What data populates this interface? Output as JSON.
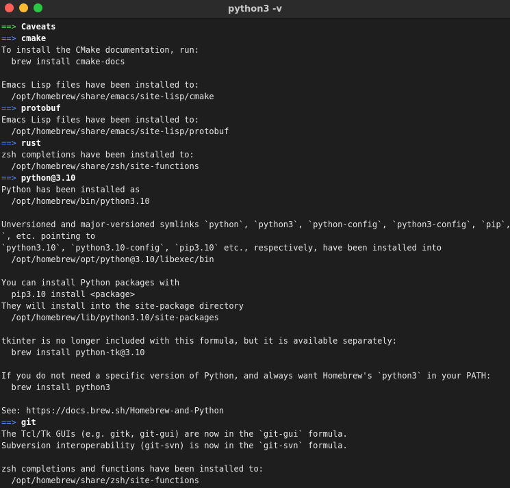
{
  "window": {
    "title": "python3 -v",
    "buttons": [
      "close",
      "minimize",
      "maximize"
    ]
  },
  "colors": {
    "green_arrow": "#5fd35f",
    "blue_arrow": "#5c8cff",
    "text": "#e6e6e6",
    "background": "#1e1e1e"
  },
  "lines": [
    {
      "type": "header",
      "arrow": "==>",
      "color": "green",
      "text": "Caveats"
    },
    {
      "type": "header",
      "arrow": "==>",
      "color": "blue",
      "text": "cmake"
    },
    {
      "type": "text",
      "text": "To install the CMake documentation, run:"
    },
    {
      "type": "text",
      "text": "  brew install cmake-docs"
    },
    {
      "type": "text",
      "text": ""
    },
    {
      "type": "text",
      "text": "Emacs Lisp files have been installed to:"
    },
    {
      "type": "text",
      "text": "  /opt/homebrew/share/emacs/site-lisp/cmake"
    },
    {
      "type": "header",
      "arrow": "==>",
      "color": "blue",
      "text": "protobuf"
    },
    {
      "type": "text",
      "text": "Emacs Lisp files have been installed to:"
    },
    {
      "type": "text",
      "text": "  /opt/homebrew/share/emacs/site-lisp/protobuf"
    },
    {
      "type": "header",
      "arrow": "==>",
      "color": "blue",
      "text": "rust"
    },
    {
      "type": "text",
      "text": "zsh completions have been installed to:"
    },
    {
      "type": "text",
      "text": "  /opt/homebrew/share/zsh/site-functions"
    },
    {
      "type": "header",
      "arrow": "==>",
      "color": "blue",
      "text": "python@3.10"
    },
    {
      "type": "text",
      "text": "Python has been installed as"
    },
    {
      "type": "text",
      "text": "  /opt/homebrew/bin/python3.10"
    },
    {
      "type": "text",
      "text": ""
    },
    {
      "type": "text",
      "text": "Unversioned and major-versioned symlinks `python`, `python3`, `python-config`, `python3-config`, `pip`, `pi"
    },
    {
      "type": "text",
      "text": "`, etc. pointing to"
    },
    {
      "type": "text",
      "text": "`python3.10`, `python3.10-config`, `pip3.10` etc., respectively, have been installed into"
    },
    {
      "type": "text",
      "text": "  /opt/homebrew/opt/python@3.10/libexec/bin"
    },
    {
      "type": "text",
      "text": ""
    },
    {
      "type": "text",
      "text": "You can install Python packages with"
    },
    {
      "type": "text",
      "text": "  pip3.10 install <package>"
    },
    {
      "type": "text",
      "text": "They will install into the site-package directory"
    },
    {
      "type": "text",
      "text": "  /opt/homebrew/lib/python3.10/site-packages"
    },
    {
      "type": "text",
      "text": ""
    },
    {
      "type": "text",
      "text": "tkinter is no longer included with this formula, but it is available separately:"
    },
    {
      "type": "text",
      "text": "  brew install python-tk@3.10"
    },
    {
      "type": "text",
      "text": ""
    },
    {
      "type": "text",
      "text": "If you do not need a specific version of Python, and always want Homebrew's `python3` in your PATH:"
    },
    {
      "type": "text",
      "text": "  brew install python3"
    },
    {
      "type": "text",
      "text": ""
    },
    {
      "type": "text",
      "text": "See: https://docs.brew.sh/Homebrew-and-Python"
    },
    {
      "type": "header",
      "arrow": "==>",
      "color": "blue",
      "text": "git"
    },
    {
      "type": "text",
      "text": "The Tcl/Tk GUIs (e.g. gitk, git-gui) are now in the `git-gui` formula."
    },
    {
      "type": "text",
      "text": "Subversion interoperability (git-svn) is now in the `git-svn` formula."
    },
    {
      "type": "text",
      "text": ""
    },
    {
      "type": "text",
      "text": "zsh completions and functions have been installed to:"
    },
    {
      "type": "text",
      "text": "  /opt/homebrew/share/zsh/site-functions"
    }
  ]
}
